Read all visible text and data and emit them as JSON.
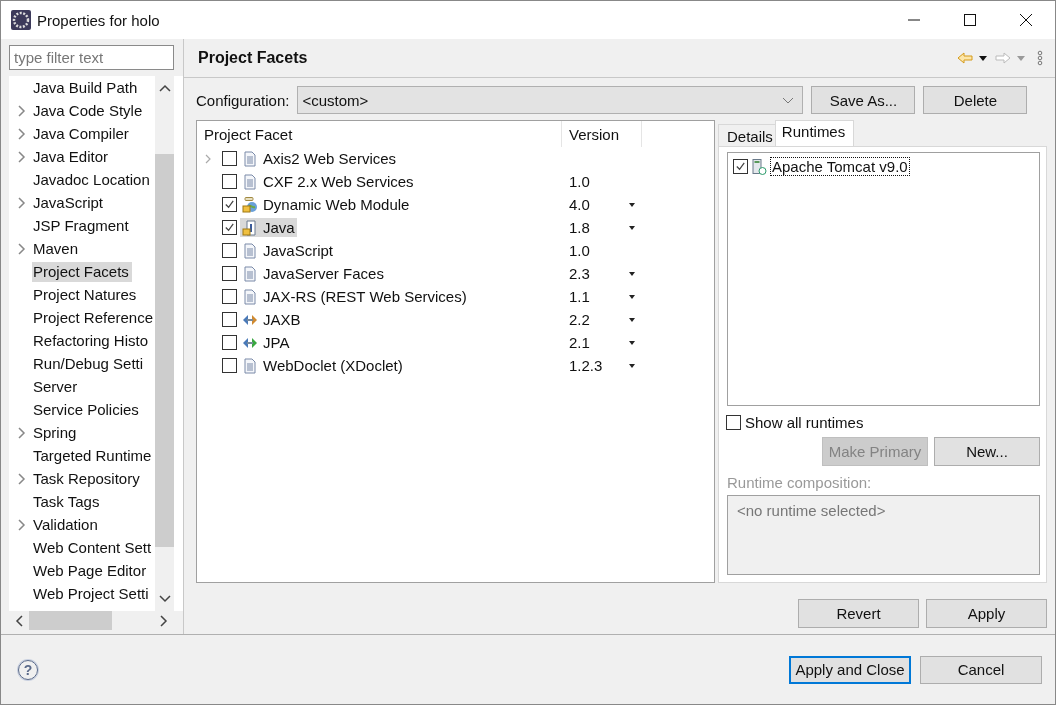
{
  "window": {
    "title": "Properties for holo"
  },
  "filter": {
    "placeholder": "type filter text"
  },
  "tree": [
    {
      "label": "Java Build Path",
      "expandable": false,
      "selected": false
    },
    {
      "label": "Java Code Style",
      "expandable": true,
      "selected": false
    },
    {
      "label": "Java Compiler",
      "expandable": true,
      "selected": false
    },
    {
      "label": "Java Editor",
      "expandable": true,
      "selected": false
    },
    {
      "label": "Javadoc Location",
      "expandable": false,
      "selected": false
    },
    {
      "label": "JavaScript",
      "expandable": true,
      "selected": false
    },
    {
      "label": "JSP Fragment",
      "expandable": false,
      "selected": false
    },
    {
      "label": "Maven",
      "expandable": true,
      "selected": false
    },
    {
      "label": "Project Facets",
      "expandable": false,
      "selected": true
    },
    {
      "label": "Project Natures",
      "expandable": false,
      "selected": false
    },
    {
      "label": "Project Reference",
      "expandable": false,
      "selected": false
    },
    {
      "label": "Refactoring Histo",
      "expandable": false,
      "selected": false
    },
    {
      "label": "Run/Debug Setti",
      "expandable": false,
      "selected": false
    },
    {
      "label": "Server",
      "expandable": false,
      "selected": false
    },
    {
      "label": "Service Policies",
      "expandable": false,
      "selected": false
    },
    {
      "label": "Spring",
      "expandable": true,
      "selected": false
    },
    {
      "label": "Targeted Runtime",
      "expandable": false,
      "selected": false
    },
    {
      "label": "Task Repository",
      "expandable": true,
      "selected": false
    },
    {
      "label": "Task Tags",
      "expandable": false,
      "selected": false
    },
    {
      "label": "Validation",
      "expandable": true,
      "selected": false
    },
    {
      "label": "Web Content Sett",
      "expandable": false,
      "selected": false
    },
    {
      "label": "Web Page Editor",
      "expandable": false,
      "selected": false
    },
    {
      "label": "Web Project Setti",
      "expandable": false,
      "selected": false
    }
  ],
  "page": {
    "title": "Project Facets"
  },
  "configuration": {
    "label": "Configuration:",
    "value": "<custom>",
    "buttons": [
      "Save As...",
      "Delete"
    ]
  },
  "facets": {
    "columns": [
      "Project Facet",
      "Version"
    ],
    "rows": [
      {
        "name": "Axis2 Web Services",
        "kind": "doc",
        "expandable": true,
        "checked": false,
        "selected": false,
        "version": "",
        "dropdown": false
      },
      {
        "name": "CXF 2.x Web Services",
        "kind": "doc",
        "expandable": false,
        "checked": false,
        "selected": false,
        "version": "1.0",
        "dropdown": false
      },
      {
        "name": "Dynamic Web Module",
        "kind": "globe",
        "expandable": false,
        "checked": true,
        "selected": false,
        "version": "4.0",
        "dropdown": true
      },
      {
        "name": "Java",
        "kind": "java",
        "expandable": false,
        "checked": true,
        "selected": true,
        "version": "1.8",
        "dropdown": true
      },
      {
        "name": "JavaScript",
        "kind": "doc",
        "expandable": false,
        "checked": false,
        "selected": false,
        "version": "1.0",
        "dropdown": false
      },
      {
        "name": "JavaServer Faces",
        "kind": "doc",
        "expandable": false,
        "checked": false,
        "selected": false,
        "version": "2.3",
        "dropdown": true
      },
      {
        "name": "JAX-RS (REST Web Services)",
        "kind": "doc",
        "expandable": false,
        "checked": false,
        "selected": false,
        "version": "1.1",
        "dropdown": true
      },
      {
        "name": "JAXB",
        "kind": "arrows",
        "expandable": false,
        "checked": false,
        "selected": false,
        "version": "2.2",
        "dropdown": true
      },
      {
        "name": "JPA",
        "kind": "arrows",
        "expandable": false,
        "checked": false,
        "selected": false,
        "version": "2.1",
        "dropdown": true
      },
      {
        "name": "WebDoclet (XDoclet)",
        "kind": "doc",
        "expandable": false,
        "checked": false,
        "selected": false,
        "version": "1.2.3",
        "dropdown": true
      }
    ]
  },
  "tabs": [
    {
      "label": "Details",
      "selected": false
    },
    {
      "label": "Runtimes",
      "selected": true
    }
  ],
  "runtimes": [
    {
      "name": "Apache Tomcat v9.0",
      "checked": true,
      "focused": true
    }
  ],
  "show_all_runtimes": {
    "label": "Show all runtimes",
    "checked": false
  },
  "runtime_buttons": [
    {
      "label": "Make Primary",
      "disabled": true
    },
    {
      "label": "New...",
      "disabled": false
    }
  ],
  "composition": {
    "label": "Runtime composition:",
    "value": "<no runtime selected>"
  },
  "page_buttons": [
    "Revert",
    "Apply"
  ],
  "help": {
    "label": "?"
  },
  "dialog_buttons": [
    {
      "label": "Apply and Close",
      "default": true
    },
    {
      "label": "Cancel",
      "default": false
    }
  ]
}
